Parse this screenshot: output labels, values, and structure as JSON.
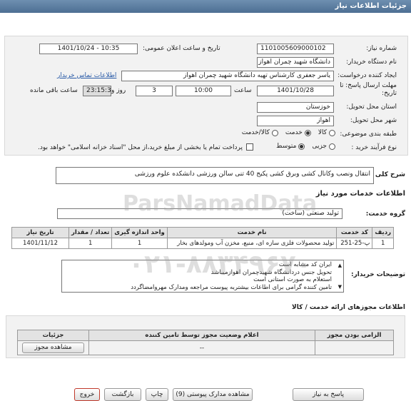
{
  "header": {
    "title": "جزئیات اطلاعات نیاز"
  },
  "fields": {
    "need_number_label": "شماره نیاز:",
    "need_number": "1101005609000102",
    "announce_label": "تاریخ و ساعت اعلان عمومی:",
    "announce_value": "1401/10/24 - 10:35",
    "buyer_label": "نام دستگاه خریدار:",
    "buyer_value": "دانشگاه شهید چمران اهواز",
    "creator_label": "ایجاد کننده درخواست:",
    "creator_value": "یاسر جعفری کارشناس تهیه دانشگاه شهید چمران اهواز",
    "contact_link": "اطلاعات تماس خریدار",
    "deadline_label": "مهلت ارسال پاسخ: تا تاریخ:",
    "deadline_date": "1401/10/28",
    "time_label": "ساعت",
    "deadline_time": "10:00",
    "days_value": "3",
    "days_label": "روز و",
    "remaining_time": "23:15:35",
    "remaining_label": "ساعت باقی مانده",
    "province_label": "استان محل تحویل:",
    "province_value": "خوزستان",
    "city_label": "شهر محل تحویل:",
    "city_value": "اهواز",
    "category_label": "طبقه بندی موضوعی:",
    "category_options": [
      "کالا",
      "خدمت",
      "کالا/خدمت"
    ],
    "process_label": "نوع فرآیند خرید :",
    "process_options": [
      "جزیی",
      "متوسط"
    ],
    "payment_note": "پرداخت تمام یا بخشی از مبلغ خرید،از محل \"اسناد خزانه اسلامی\" خواهد بود."
  },
  "summary": {
    "label": "شرح کلی نیاز:",
    "value": "انتقال ونصب وکانال کشی وبرق کشی پکیج 40 تنی سالن ورزشی دانشکده علوم ورزشی"
  },
  "services": {
    "title": "اطلاعات خدمات مورد نیاز",
    "group_label": "گروه خدمت:",
    "group_value": "تولید صنعتی (ساخت)",
    "columns": [
      "ردیف",
      "کد خدمت",
      "نام خدمت",
      "واحد اندازه گیری",
      "تعداد / مقدار",
      "تاریخ نیاز"
    ],
    "rows": [
      [
        "1",
        "پ-25-251",
        "تولید محصولات فلزی سازه ای، منبع، مخزن آب ومولدهای بخار",
        "1",
        "1",
        "1401/11/12"
      ]
    ]
  },
  "buyer_notes": {
    "label": "توضیحات خریدار:",
    "lines": [
      "ایران کد مشابه است",
      "تحویل جنس دردانشگاه شهیدچمران اهوازمیباشد",
      "استعلام به صورت استانی است",
      "تامین کننده گرامی برای اطاعات بیشتربه پیوست مراجعه ومدارک مهروامضاگردد"
    ]
  },
  "licenses": {
    "title": "اطلاعات مجوزهای ارائه خدمت / کالا",
    "columns": [
      "الزامی بودن مجوز",
      "اعلام وضعیت مجوز توسط تامین کننده",
      "جزئیات"
    ],
    "rows": [
      [
        "",
        "--",
        "مشاهده مجوز"
      ]
    ]
  },
  "buttons": {
    "reply": "پاسخ به نیاز",
    "view_docs": "مشاهده مدارک پیوستی (9)",
    "print": "چاپ",
    "back": "بازگشت",
    "exit": "خروج"
  },
  "watermark": {
    "main": "ParsNamadData",
    "phone": "۰۲۱-۸۸۳۴۹۶۷۰"
  }
}
